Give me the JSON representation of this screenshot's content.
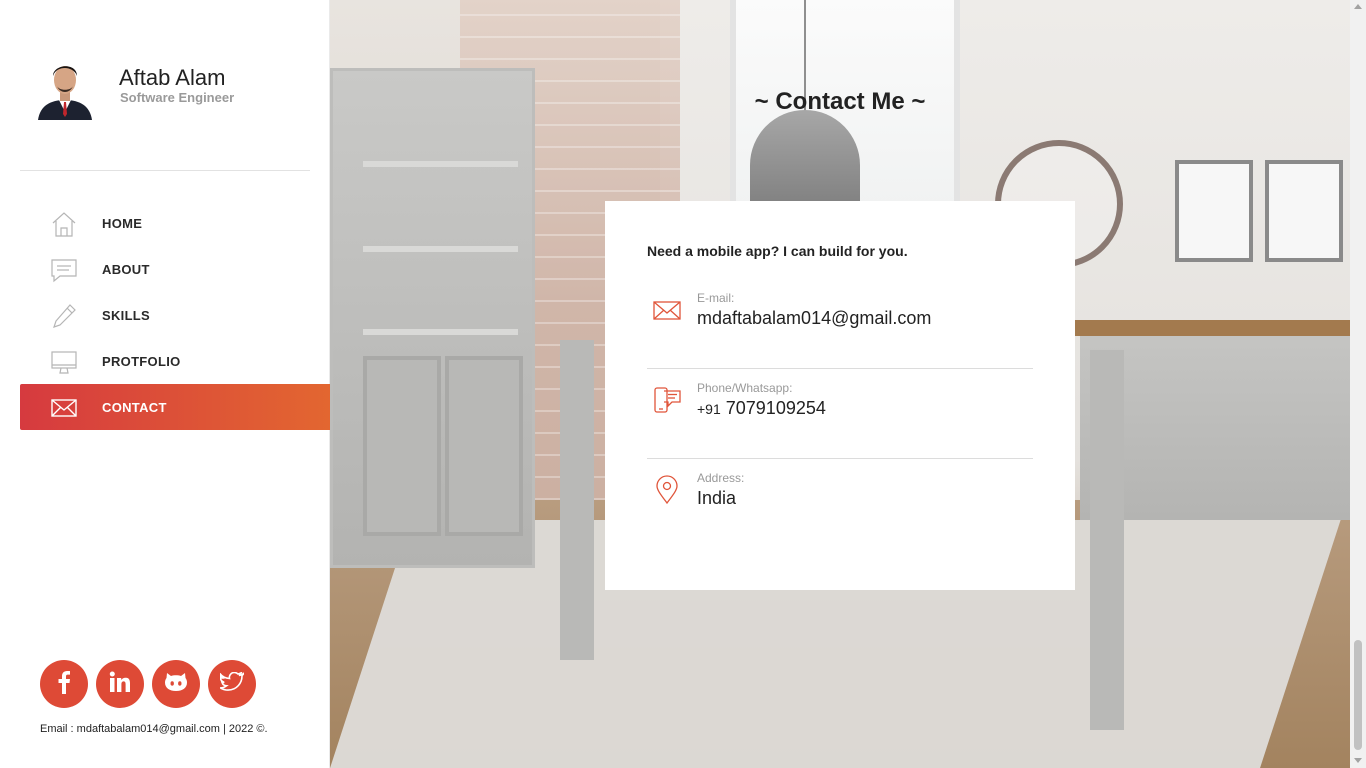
{
  "profile": {
    "name": "Aftab Alam",
    "role": "Software Engineer"
  },
  "nav": {
    "items": [
      {
        "label": "HOME",
        "icon": "home-icon",
        "active": false
      },
      {
        "label": "ABOUT",
        "icon": "chat-icon",
        "active": false
      },
      {
        "label": "SKILLS",
        "icon": "pencil-icon",
        "active": false
      },
      {
        "label": "PROTFOLIO",
        "icon": "monitor-icon",
        "active": false
      },
      {
        "label": "CONTACT",
        "icon": "envelope-icon",
        "active": true
      }
    ]
  },
  "socials": [
    {
      "icon": "facebook-icon"
    },
    {
      "icon": "linkedin-icon"
    },
    {
      "icon": "github-icon"
    },
    {
      "icon": "twitter-icon"
    }
  ],
  "footer": {
    "text": "Email : mdaftabalam014@gmail.com | 2022 ©."
  },
  "contact": {
    "title": "~ Contact Me ~",
    "intro": "Need a mobile app? I can build for you.",
    "email_label": "E-mail:",
    "email_value": "mdaftabalam014@gmail.com",
    "phone_label": "Phone/Whatsapp:",
    "phone_prefix": "+91",
    "phone_value": "7079109254",
    "address_label": "Address:",
    "address_value": "India"
  },
  "colors": {
    "accent_start": "#d63a3f",
    "accent_end": "#e36730",
    "social_bg": "#de4a36",
    "icon_stroke": "#e0553a"
  }
}
